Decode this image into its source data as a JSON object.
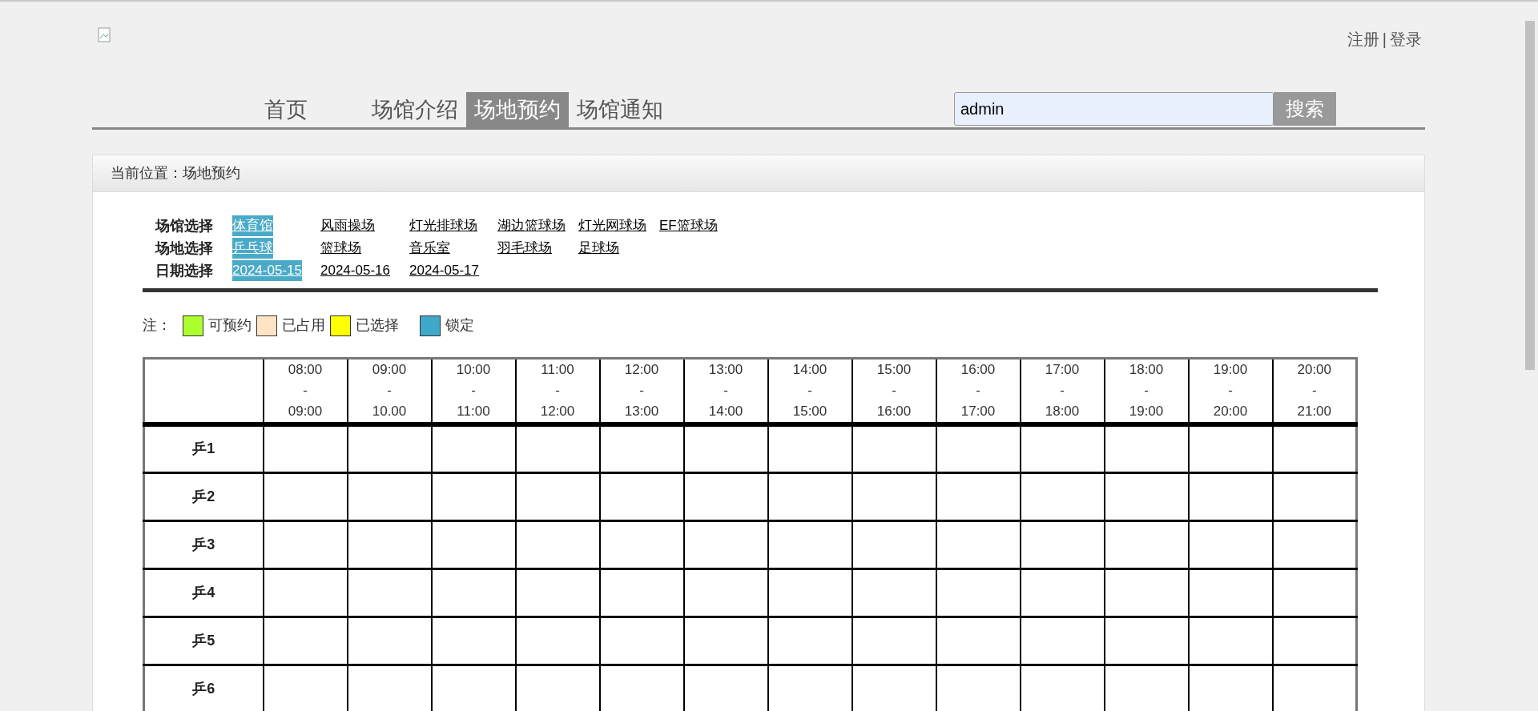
{
  "header": {
    "links": [
      "注册",
      "登录"
    ],
    "separator": "|"
  },
  "nav": {
    "tabs": [
      {
        "label": "首页",
        "selected": false
      },
      {
        "label": "场馆介绍",
        "selected": false
      },
      {
        "label": "场地预约",
        "selected": true
      },
      {
        "label": "场馆通知",
        "selected": false
      }
    ],
    "search": {
      "value": "admin",
      "button": "搜索"
    }
  },
  "breadcrumb": "当前位置：场地预约",
  "filters": [
    {
      "label": "场馆选择",
      "options": [
        {
          "label": "体育馆",
          "selected": true
        },
        {
          "label": "风雨操场",
          "selected": false
        },
        {
          "label": "灯光排球场",
          "selected": false
        },
        {
          "label": "湖边篮球场",
          "selected": false
        },
        {
          "label": "灯光网球场",
          "selected": false
        },
        {
          "label": "EF篮球场",
          "selected": false
        }
      ]
    },
    {
      "label": "场地选择",
      "options": [
        {
          "label": "乒乓球",
          "selected": true
        },
        {
          "label": "篮球场",
          "selected": false
        },
        {
          "label": "音乐室",
          "selected": false
        },
        {
          "label": "羽毛球场",
          "selected": false
        },
        {
          "label": "足球场",
          "selected": false
        }
      ]
    },
    {
      "label": "日期选择",
      "options": [
        {
          "label": "2024-05-15",
          "selected": true
        },
        {
          "label": "2024-05-16",
          "selected": false
        },
        {
          "label": "2024-05-17",
          "selected": false
        }
      ]
    }
  ],
  "legend": {
    "title": "注：",
    "items": [
      {
        "label": "可预约",
        "color": "#adff2f"
      },
      {
        "label": "已占用",
        "color": "#ffe4c4"
      },
      {
        "label": "已选择",
        "color": "#ffff00"
      },
      {
        "label": "锁定",
        "color": "#40a8c8"
      }
    ]
  },
  "schedule": {
    "columns": [
      {
        "start": "08:00",
        "dash": "-",
        "end": "09:00"
      },
      {
        "start": "09:00",
        "dash": "-",
        "end": "10.00"
      },
      {
        "start": "10:00",
        "dash": "-",
        "end": "11:00"
      },
      {
        "start": "11:00",
        "dash": "-",
        "end": "12:00"
      },
      {
        "start": "12:00",
        "dash": "-",
        "end": "13:00"
      },
      {
        "start": "13:00",
        "dash": "-",
        "end": "14:00"
      },
      {
        "start": "14:00",
        "dash": "-",
        "end": "15:00"
      },
      {
        "start": "15:00",
        "dash": "-",
        "end": "16:00"
      },
      {
        "start": "16:00",
        "dash": "-",
        "end": "17:00"
      },
      {
        "start": "17:00",
        "dash": "-",
        "end": "18:00"
      },
      {
        "start": "18:00",
        "dash": "-",
        "end": "19:00"
      },
      {
        "start": "19:00",
        "dash": "-",
        "end": "20:00"
      },
      {
        "start": "20:00",
        "dash": "-",
        "end": "21:00"
      }
    ],
    "rows": [
      "乒1",
      "乒2",
      "乒3",
      "乒4",
      "乒5",
      "乒6"
    ]
  }
}
